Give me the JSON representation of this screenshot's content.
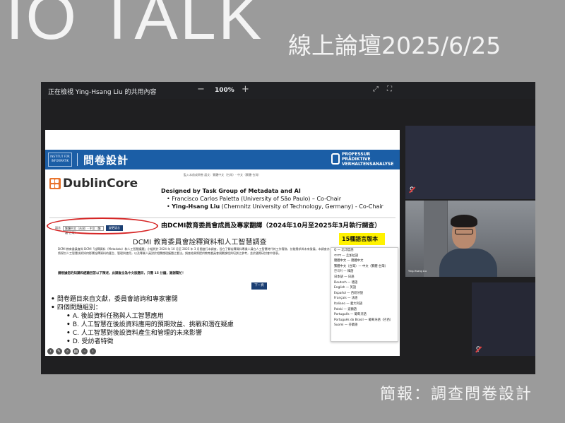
{
  "banner": {
    "title": "IO TALK",
    "subtitle": "線上論壇2025/6/25",
    "caption": "簡報：調查問卷設計"
  },
  "meet": {
    "share_text": "正在檢視 Ying-Hsang Liu 的共用內容",
    "zoom_minus": "−",
    "zoom_level": "100%",
    "zoom_plus": "+"
  },
  "slide": {
    "header_title": "問卷設計",
    "header_logo": "INSTITUT FÜR INFORMATIK",
    "professur": [
      "PROFESSUR",
      "PRÄDIKTIVE",
      "VERHALTENSANALYSE"
    ],
    "lang_tiny": "監入本前成問卷  語文：繁體中文（台灣）- 中文（繁體-台灣）",
    "dc_logo": "DublinCore",
    "credits_title": "Designed by Task Group of Metadata and AI",
    "credit_1": "Francisco Carlos Paletta (University of São Paulo) – Co-Chair",
    "credit_2_name": "Ying-Hsang Liu",
    "credit_2_rest": " (Chemnitz University of Technology, Germany) - Co-Chair",
    "lang_select_label": "語言",
    "lang_select_value": "繁體中文（台灣）- 中文（繁體-台灣）",
    "lang_select_btn": "變更語言",
    "annot_done": "由DCMI教育委員會成員及專家翻譯（2024年10月至2025年3月執行調查）",
    "annot_15": "15種語言版本",
    "dcmi_title": "DCMI 教育委員會詮釋資料和人工智慧調查",
    "intro": "DCMI 教育委員會與 DCMI「詮釋資料（Metadata）和人工智慧議題」小組將於 2024 年 10 月至 2025 年 3 月間進行本調查，旨在了解詮釋資料專業人員在人工智慧時代的工作實務、技能需求與未來發展。本調查亦將探討人工智慧技術如何影響詮釋資料的產生、管理與使用，以及專業人員對於相關倫理議題之看法。調查結果將提供教育委員會規劃課程與培訓之參考，並於國際研討會中發表。",
    "intro_em": "請根據您的知識和經驗回答以下陳述，此調查全為中文版題目，只需 15 分鐘，謝謝幫忙！",
    "next_btn": "下一頁",
    "bullet_1": "問卷題目來自文獻，委員會諮詢和專家審閱",
    "bullet_2": "四個問題組別：",
    "sub_a": "A. 後設資料任務與人工智慧應用",
    "sub_b": "B. 人工智慧在後設資料應用的預期效益、挑戰和潛在疑慮",
    "sub_c": "C. 人工智慧對後設資料產生和管理的未來影響",
    "sub_d": "D. 受訪者特徵",
    "languages": [
      "Q — 北印度語",
      "বাংলা — 孟加拉語",
      "簡體中文 — 簡體中文",
      "繁體中文（台灣）— 中文（繁體-台灣）",
      "한국어 — 韓語",
      "日本語 — 日語",
      "Deutsch — 德語",
      "English — 英語",
      "Español — 西班牙語",
      "Français — 法語",
      "Italiano — 義大利語",
      "Polski — 波蘭語",
      "Português — 葡萄牙語",
      "Português do Brasil — 葡萄牙語（巴西）",
      "Suomi — 芬蘭語"
    ]
  },
  "participants": {
    "cam_name": "Ying-Hsang Liu"
  },
  "colors": {
    "background": "#9b9b9b",
    "meet_bg": "#1f1f21",
    "header_blue": "#1b5ea6",
    "highlight": "#fff200",
    "oval_red": "#d62424"
  }
}
